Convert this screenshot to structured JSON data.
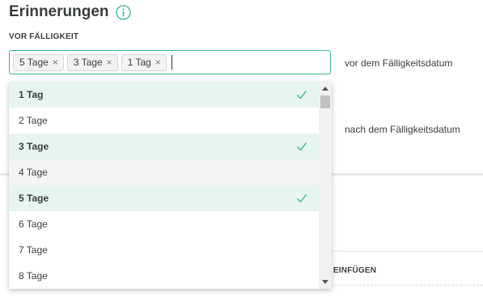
{
  "header": {
    "title": "Erinnerungen",
    "info_icon": "info-icon"
  },
  "section": {
    "label": "VOR FÄLLIGKEIT"
  },
  "tag_input": {
    "chips": [
      {
        "label": "5 Tage",
        "remove": "×"
      },
      {
        "label": "3 Tage",
        "remove": "×"
      },
      {
        "label": "1 Tag",
        "remove": "×"
      }
    ]
  },
  "side_labels": {
    "before": "vor dem Fälligkeitsdatum",
    "after": "nach dem Fälligkeitsdatum"
  },
  "background": {
    "partial_label": "N) EINFÜGEN"
  },
  "dropdown": {
    "options": [
      {
        "label": "1 Tag",
        "selected": true
      },
      {
        "label": "2 Tage",
        "selected": false
      },
      {
        "label": "3 Tage",
        "selected": true
      },
      {
        "label": "4 Tage",
        "selected": false,
        "hover": true
      },
      {
        "label": "5 Tage",
        "selected": true
      },
      {
        "label": "6 Tage",
        "selected": false
      },
      {
        "label": "7 Tage",
        "selected": false
      },
      {
        "label": "8 Tage",
        "selected": false
      }
    ],
    "check_icon": "checkmark-icon"
  },
  "colors": {
    "accent": "#39b39a",
    "selected_bg": "#e7f5f1",
    "text": "#3a3d3f"
  }
}
